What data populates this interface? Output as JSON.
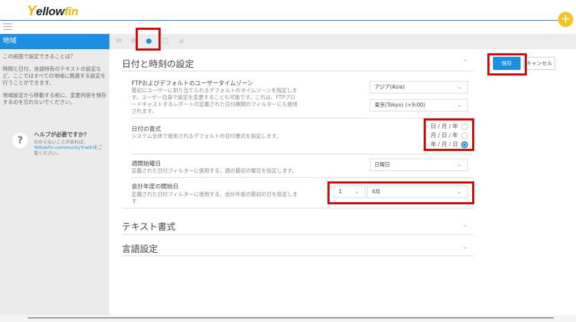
{
  "app": {
    "logo_prefix": "Y",
    "logo_mid": "ellow",
    "logo_suffix": "fin",
    "plus_label": "+"
  },
  "sidebar": {
    "title": "地域",
    "question": "この画面で設定できることは？",
    "para1": "時間と日付、言語特有のテキストの設定など、ここではすべての地域に関連する設定を行うことができます。",
    "para2": "地域設定から移動する前に、変更内容を保存するのを忘れないでください。",
    "help_icon": "?",
    "help_title": "ヘルプが必要ですか？",
    "help_text1": "わからないことがあれば、",
    "help_link": "Yellowfin communityやwiki",
    "help_text2": "をご覧ください。"
  },
  "tabs": [
    {
      "icon": "envelope-icon",
      "glyph": "✉"
    },
    {
      "icon": "gear-icon",
      "glyph": "⚙"
    },
    {
      "icon": "globe-icon",
      "glyph": "●"
    },
    {
      "icon": "lock-icon",
      "glyph": "□"
    },
    {
      "icon": "link-icon",
      "glyph": "⌀"
    }
  ],
  "actions": {
    "save": "保存",
    "cancel": "キャンセル"
  },
  "datetime": {
    "heading": "日付と時刻の設定",
    "tz_title": "FTPおよびデフォルトのユーザータイムゾーン",
    "tz_desc1": "最初にユーザーに割り当てられるデフォルトのタイムゾーンを指定しま",
    "tz_desc2": "す。ユーザー自身で設定を変更することも可能です。これは、FTPブロ",
    "tz_desc3": "ードキャストするレポートの定義された日付期間のフィルターにも使用",
    "tz_desc4": "されます。",
    "region_value": "アジア(Asia)",
    "city_value": "東京(Tokyo) (+9:00)",
    "fmt_title": "日付の書式",
    "fmt_desc": "システム全体で使用されるデフォルトの日付書式を指定します。",
    "fmt_options": [
      "日 / 月 / 年",
      "月 / 日 / 年",
      "年 / 月 / 日"
    ],
    "fmt_selected_index": 2,
    "week_title": "週開始曜日",
    "week_desc": "定義された日付フィルターに使用する、週の最初の曜日を指定します。",
    "week_value": "日曜日",
    "fy_title": "会計年度の開始日",
    "fy_desc1": "定義された日付フィルターに使用する、会計年度の最初の日を指定しま",
    "fy_desc2": "す",
    "fy_day": "1",
    "fy_month": "4月"
  },
  "sections": {
    "text_format": "テキスト書式",
    "language": "言語設定"
  },
  "colors": {
    "accent": "#1a8fe3",
    "logo": "#f4b400",
    "highlight": "#e00000"
  }
}
